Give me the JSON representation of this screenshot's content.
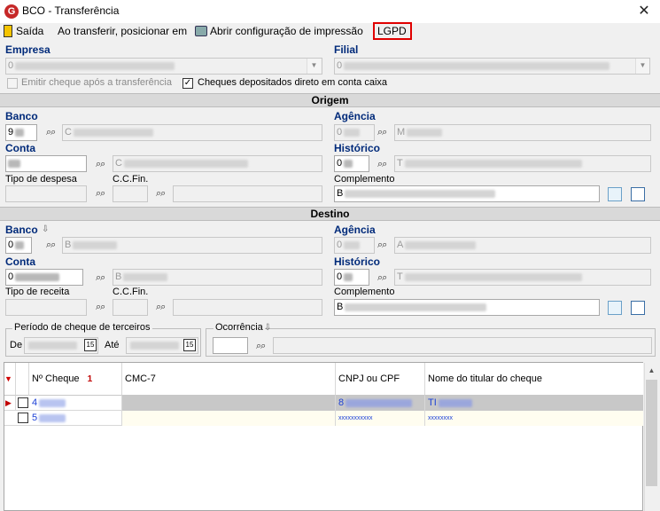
{
  "window": {
    "title": "BCO - Transferência",
    "close_glyph": "✕"
  },
  "menu": {
    "exit": "Saída",
    "on_transfer": "Ao transferir, posicionar em",
    "print_config": "Abrir configuração de impressão",
    "lgpd": "LGPD"
  },
  "top": {
    "empresa_label": "Empresa",
    "empresa_value": "0",
    "filial_label": "Filial",
    "filial_value": "0",
    "emitir_cheque": "Emitir cheque após a transferência",
    "cheques_depositados": "Cheques depositados direto em conta caixa",
    "cheques_depositados_checked": "✓"
  },
  "origem": {
    "section": "Origem",
    "banco_label": "Banco",
    "banco_code": "9",
    "banco_name": "C",
    "agencia_label": "Agência",
    "agencia_code": "0",
    "agencia_name": "M",
    "conta_label": "Conta",
    "conta_name": "C",
    "historico_label": "Histórico",
    "historico_code": "0",
    "historico_name": "T",
    "tipo_despesa_label": "Tipo de despesa",
    "ccfin_label": "C.C.Fin.",
    "complemento_label": "Complemento",
    "complemento_value": "B"
  },
  "destino": {
    "section": "Destino",
    "banco_label": "Banco",
    "banco_code": "0",
    "banco_name": "B",
    "agencia_label": "Agência",
    "agencia_code": "0",
    "agencia_name": "A",
    "conta_label": "Conta",
    "conta_code": "0",
    "conta_name": "B",
    "historico_label": "Histórico",
    "historico_code": "0",
    "historico_name": "T",
    "tipo_receita_label": "Tipo de receita",
    "ccfin_label": "C.C.Fin.",
    "complemento_label": "Complemento",
    "complemento_value": "B"
  },
  "filters": {
    "periodo_label": "Período de cheque de terceiros",
    "de_label": "De",
    "ate_label": "Até",
    "cal_glyph": "15",
    "ocorrencia_label": "Ocorrência"
  },
  "grid": {
    "columns": [
      "Nº Cheque",
      "CMC-7",
      "CNPJ ou CPF",
      "Nome do titular do cheque"
    ],
    "sort_indicator": "1",
    "rows": [
      {
        "cheque": "4",
        "cmc7": "",
        "cnpj": "8",
        "nome": "TI"
      },
      {
        "cheque": "5",
        "cmc7": "",
        "cnpj": "xxxxxxxxxxx",
        "nome": "xxxxxxxx"
      }
    ]
  },
  "colors": {
    "label_blue": "#002a7a",
    "link_blue": "#1a3fd6",
    "lgpd_highlight": "#e00000",
    "selected_row": "#c8c8c8"
  }
}
